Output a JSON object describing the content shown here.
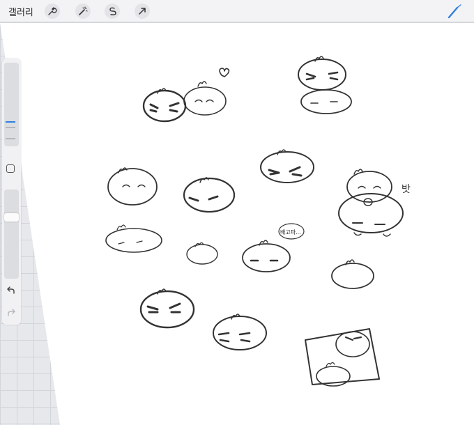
{
  "toolbar": {
    "gallery_label": "갤러리",
    "tools": [
      "wrench-icon",
      "magic-wand-icon",
      "selection-icon",
      "transform-arrow-icon"
    ],
    "active_tool": "brush-icon",
    "accent_color": "#2f7fe0"
  },
  "sidebar": {
    "brush_size_level": 0.55,
    "opacity_level": 0.62,
    "undo_icon": "undo-icon",
    "redo_icon": "redo-icon"
  },
  "canvas": {
    "sticker_text_sigh": "밧",
    "sticker_text_bubble": "배고파..."
  }
}
